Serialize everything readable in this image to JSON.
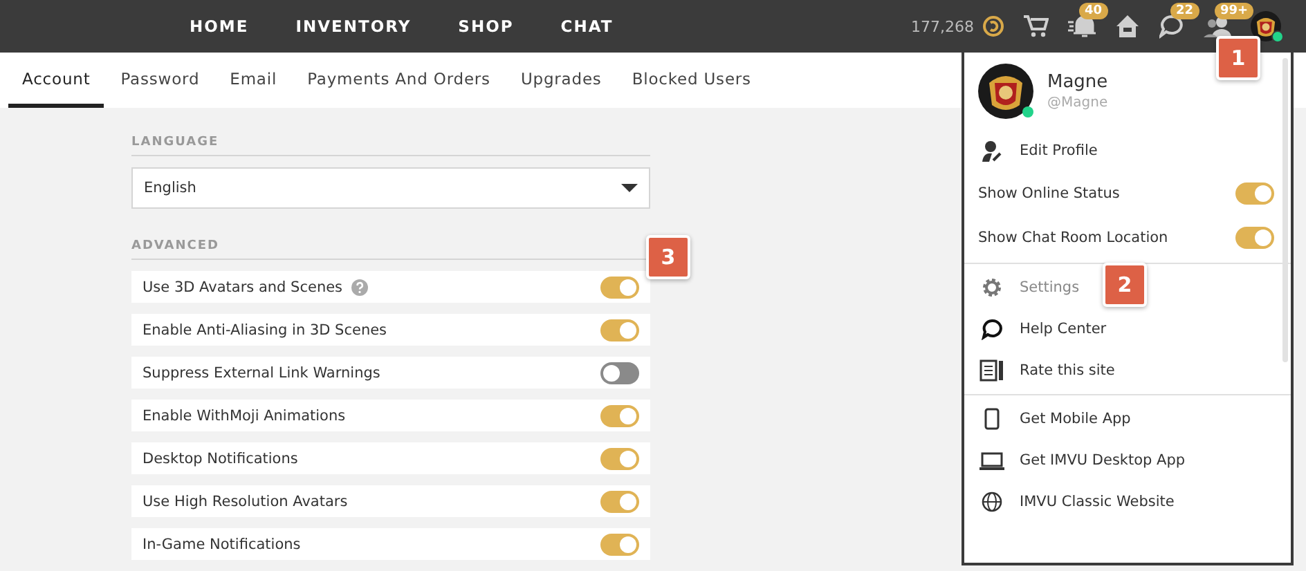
{
  "nav": {
    "links": [
      {
        "label": "HOME"
      },
      {
        "label": "INVENTORY"
      },
      {
        "label": "SHOP"
      },
      {
        "label": "CHAT"
      }
    ],
    "credits": "177,268",
    "icons": [
      {
        "kind": "cart"
      },
      {
        "kind": "bell",
        "badge": "40"
      },
      {
        "kind": "house"
      },
      {
        "kind": "chat",
        "badge": "22"
      },
      {
        "kind": "friends",
        "badge": "99+"
      },
      {
        "kind": "avatar",
        "online": true
      }
    ]
  },
  "tabs": [
    {
      "label": "Account",
      "selected": true
    },
    {
      "label": "Password",
      "selected": false
    },
    {
      "label": "Email",
      "selected": false
    },
    {
      "label": "Payments And Orders",
      "selected": false
    },
    {
      "label": "Upgrades",
      "selected": false
    },
    {
      "label": "Blocked Users",
      "selected": false
    }
  ],
  "language": {
    "heading": "LANGUAGE",
    "value": "English"
  },
  "advanced": {
    "heading": "ADVANCED",
    "settings": [
      {
        "label": "Use 3D Avatars and Scenes",
        "help": true,
        "on": true
      },
      {
        "label": "Enable Anti-Aliasing in 3D Scenes",
        "help": false,
        "on": true
      },
      {
        "label": "Suppress External Link Warnings",
        "help": false,
        "on": false
      },
      {
        "label": "Enable WithMoji Animations",
        "help": false,
        "on": true
      },
      {
        "label": "Desktop Notifications",
        "help": false,
        "on": true
      },
      {
        "label": "Use High Resolution Avatars",
        "help": false,
        "on": true
      },
      {
        "label": "In-Game Notifications",
        "help": false,
        "on": true
      }
    ]
  },
  "user_menu": {
    "name": "Magne",
    "handle": "@Magne",
    "online": true,
    "sections": [
      [
        {
          "kind": "link",
          "label": "Edit Profile"
        },
        {
          "kind": "toggle",
          "label": "Show Online Status",
          "on": true
        },
        {
          "kind": "toggle",
          "label": "Show Chat Room Location",
          "on": true
        }
      ],
      [
        {
          "kind": "link",
          "label": "Settings",
          "disabled": true
        },
        {
          "kind": "link",
          "label": "Help Center",
          "disabled": false
        },
        {
          "kind": "link",
          "label": "Rate this site",
          "disabled": false
        }
      ],
      [
        {
          "kind": "link",
          "label": "Get Mobile App"
        },
        {
          "kind": "link",
          "label": "Get IMVU Desktop App"
        },
        {
          "kind": "link",
          "label": "IMVU Classic Website"
        }
      ]
    ]
  },
  "callouts": [
    {
      "label": "1"
    },
    {
      "label": "2"
    },
    {
      "label": "3"
    }
  ]
}
